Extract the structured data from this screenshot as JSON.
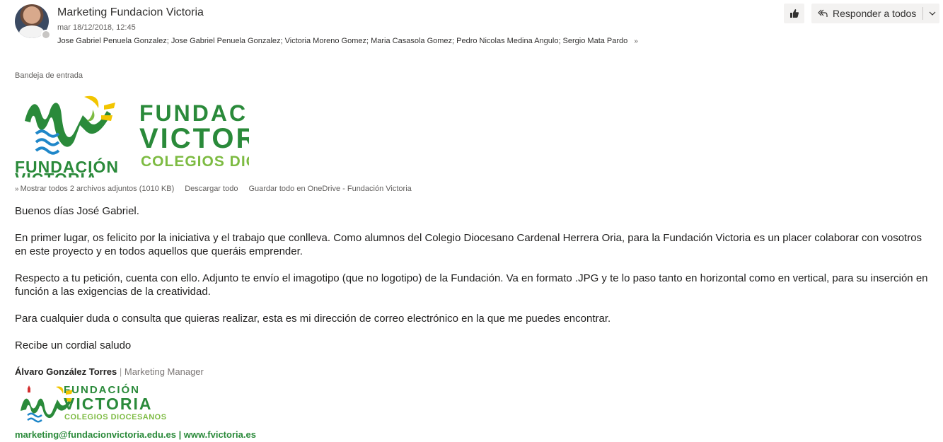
{
  "header": {
    "subject": "Marketing Fundacion Victoria",
    "date": "mar 18/12/2018, 12:45",
    "recipients": "Jose Gabriel Penuela Gonzalez; Jose Gabriel Penuela Gonzalez; Victoria Moreno Gomez; Maria Casasola Gomez; Pedro Nicolas Medina Angulo; Sergio Mata Pardo",
    "expand_glyph": "»"
  },
  "toolbar": {
    "reply_all_label": "Responder a todos"
  },
  "folder": "Bandeja de entrada",
  "attachments": {
    "vertical_logo": {
      "line1": "FUNDACIÓN",
      "line2": "VICTORIA"
    },
    "horizontal_logo": {
      "line1": "FUNDACIÓN",
      "line2": "VICTORIA",
      "line3": "COLEGIOS DIOCESANOS"
    },
    "show_all": "Mostrar todos 2 archivos adjuntos (1010 KB)",
    "download_all": "Descargar todo",
    "save_onedrive": "Guardar todo en OneDrive - Fundación Victoria"
  },
  "body": {
    "greeting": "Buenos días José Gabriel.",
    "p1": "En primer lugar, os felicito por la iniciativa y el trabajo que conlleva. Como alumnos del Colegio Diocesano Cardenal Herrera Oria, para la Fundación Victoria es un placer colaborar con vosotros en este proyecto y en todos aquellos que queráis emprender.",
    "p2": "Respecto a tu petición, cuenta con ello. Adjunto te envío el imagotipo (que no logotipo) de la Fundación. Va en formato .JPG y te lo paso tanto en horizontal como en vertical, para su inserción en función a las exigencias de la creatividad.",
    "p3": "Para cualquier duda o consulta que quieras realizar, esta es mi dirección de correo electrónico en la que me puedes encontrar.",
    "closing": "Recibe un cordial saludo"
  },
  "signature": {
    "name": "Álvaro González Torres",
    "separator": " | ",
    "role": "Marketing Manager",
    "logo": {
      "line1": "FUNDACIÓN",
      "line2": "VICTORIA",
      "line3": "COLEGIOS DIOCESANOS"
    },
    "contact": "marketing@fundacionvictoria.edu.es | www.fvictoria.es"
  },
  "colors": {
    "brand_green": "#2a8a3a",
    "brand_light_green": "#7dbb42",
    "brand_yellow": "#f2c500",
    "brand_blue": "#1f87c9"
  }
}
